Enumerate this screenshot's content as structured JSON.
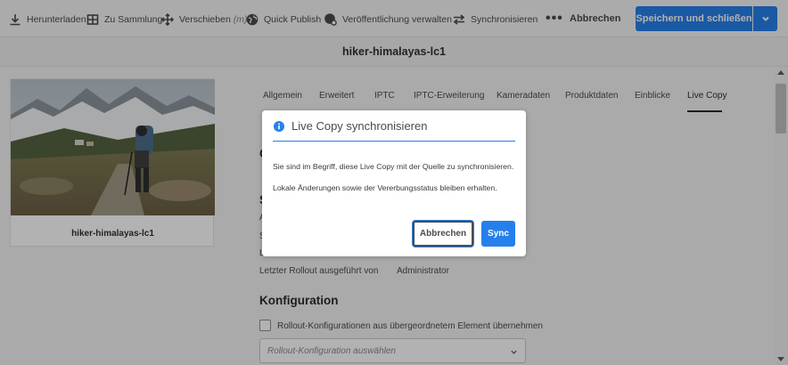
{
  "toolbar": {
    "download": "Herunterladen",
    "to_collection": "Zu Sammlung",
    "move": "Verschieben",
    "move_hint": "(m)",
    "quick_publish": "Quick Publish",
    "manage_publication": "Veröffentlichung verwalten",
    "synchronize": "Synchronisieren",
    "more": "•••",
    "cancel": "Abbrechen",
    "save_close": "Speichern und schließen"
  },
  "title": "hiker-himalayas-lc1",
  "asset": {
    "name": "hiker-himalayas-lc1"
  },
  "tabs": [
    "Allgemein",
    "Erweitert",
    "IPTC",
    "IPTC-Erweiterung",
    "Kameradaten",
    "Produktdaten",
    "Einblicke",
    "Live Copy"
  ],
  "active_tab": "Live Copy",
  "form": {
    "section_c_initial": "C",
    "section_s_initial": "S",
    "row_initial_a": "A",
    "row_initial_s": "S",
    "row_initial_l": "L",
    "last_rollout_label": "Letzter Rollout ausgeführt von",
    "last_rollout_value": "Administrator",
    "config_heading": "Konfiguration",
    "inherit_checkbox_label": "Rollout-Konfigurationen aus übergeordnetem Element übernehmen",
    "rollout_select_placeholder": "Rollout-Konfiguration auswählen"
  },
  "dialog": {
    "title": "Live Copy synchronisieren",
    "line1": "Sie sind im Begriff, diese Live Copy mit der Quelle zu synchronisieren.",
    "line2": "Lokale Änderungen sowie der Vererbungsstatus bleiben erhalten.",
    "cancel": "Abbrechen",
    "confirm": "Sync"
  },
  "colors": {
    "accent": "#2680eb",
    "text": "#4b4b4b",
    "overlay": "rgba(0,0,0,0.30)"
  },
  "icons": {
    "download": "download-icon",
    "collection": "collection-icon",
    "move": "move-icon",
    "quick_publish": "globe-icon",
    "manage_publication": "globe-gear-icon",
    "synchronize": "sync-arrows-icon",
    "info": "info-icon",
    "dropdown": "chevron-down-icon"
  }
}
